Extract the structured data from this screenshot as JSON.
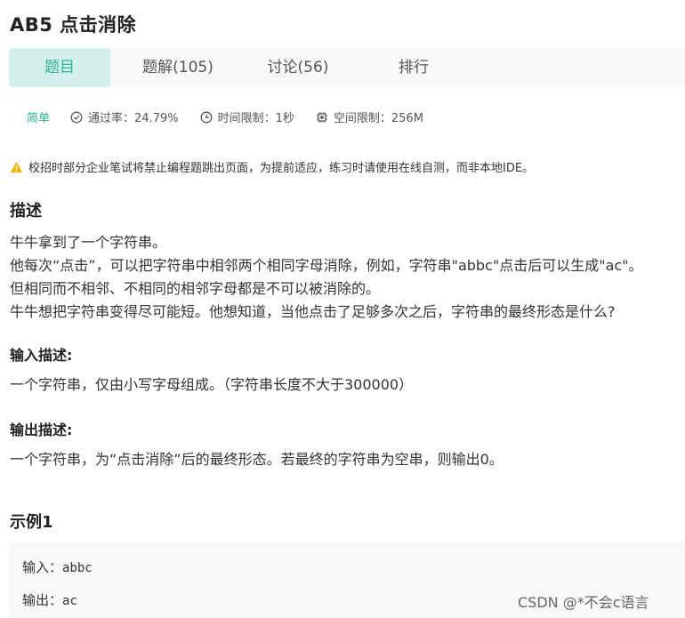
{
  "problem": {
    "title": "AB5  点击消除"
  },
  "tabs": [
    {
      "label": "题目"
    },
    {
      "label": "题解(105)"
    },
    {
      "label": "讨论(56)"
    },
    {
      "label": "排行"
    }
  ],
  "meta": {
    "level": "简单",
    "pass_rate": "通过率：24.79%",
    "time_limit": "时间限制：1秒",
    "space_limit": "空间限制：256M"
  },
  "warning": "校招时部分企业笔试将禁止编程题跳出页面，为提前适应，练习时请使用在线自测，而非本地IDE。",
  "description": {
    "heading": "描述",
    "lines": [
      "牛牛拿到了一个字符串。",
      "他每次“点击”，可以把字符串中相邻两个相同字母消除，例如，字符串\"abbc\"点击后可以生成\"ac\"。",
      "但相同而不相邻、不相同的相邻字母都是不可以被消除的。",
      "牛牛想把字符串变得尽可能短。他想知道，当他点击了足够多次之后，字符串的最终形态是什么?"
    ]
  },
  "input_desc": {
    "heading": "输入描述:",
    "text": "一个字符串，仅由小写字母组成。（字符串长度不大于300000）"
  },
  "output_desc": {
    "heading": "输出描述:",
    "text": "一个字符串，为“点击消除”后的最终形态。若最终的字符串为空串，则输出0。"
  },
  "example": {
    "heading": "示例1",
    "input_label": "输入：",
    "input_value": "abbc",
    "output_label": "输出：",
    "output_value": "ac"
  },
  "watermark": "CSDN @*不会c语言",
  "colors": {
    "accent": "#2fb492",
    "tab_active_bg": "#d3f1ea",
    "warning": "#f5b400"
  }
}
